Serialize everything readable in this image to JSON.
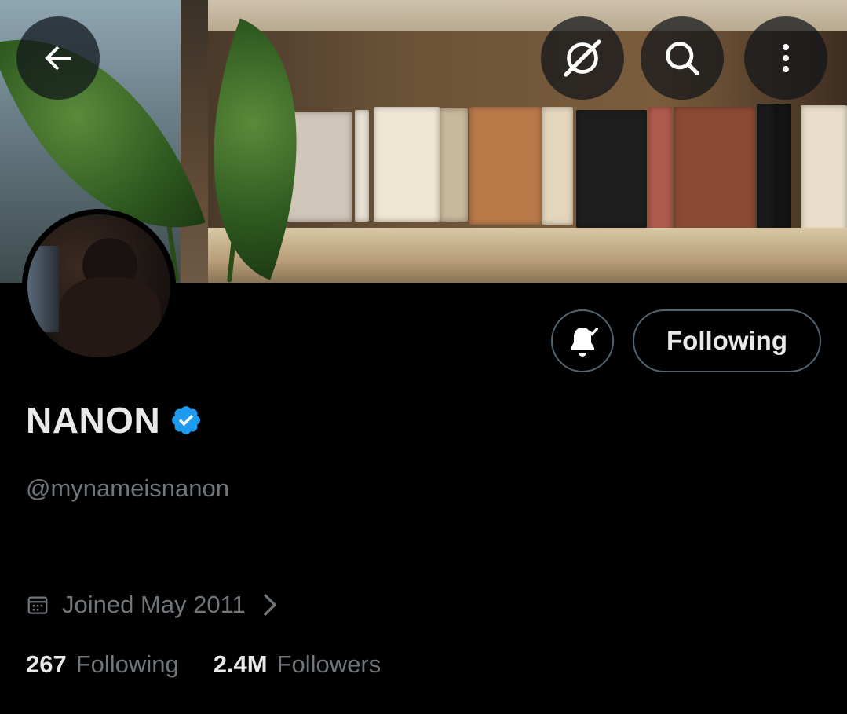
{
  "header": {
    "back_icon": "arrow-left-icon",
    "grok_icon": "grok-icon",
    "search_icon": "search-icon",
    "more_icon": "more-vertical-icon"
  },
  "actions": {
    "notification_icon": "bell-check-icon",
    "following_label": "Following"
  },
  "profile": {
    "name": "NANON",
    "verified_color": "#1d9bf0",
    "handle": "@mynameisnanon",
    "joined": "Joined May 2011",
    "following_count": "267",
    "following_label": "Following",
    "followers_count": "2.4M",
    "followers_label": "Followers"
  },
  "colors": {
    "background": "#000000",
    "text_primary": "#e7e9ea",
    "text_secondary": "#71767b",
    "border": "#536471",
    "accent": "#1d9bf0"
  }
}
